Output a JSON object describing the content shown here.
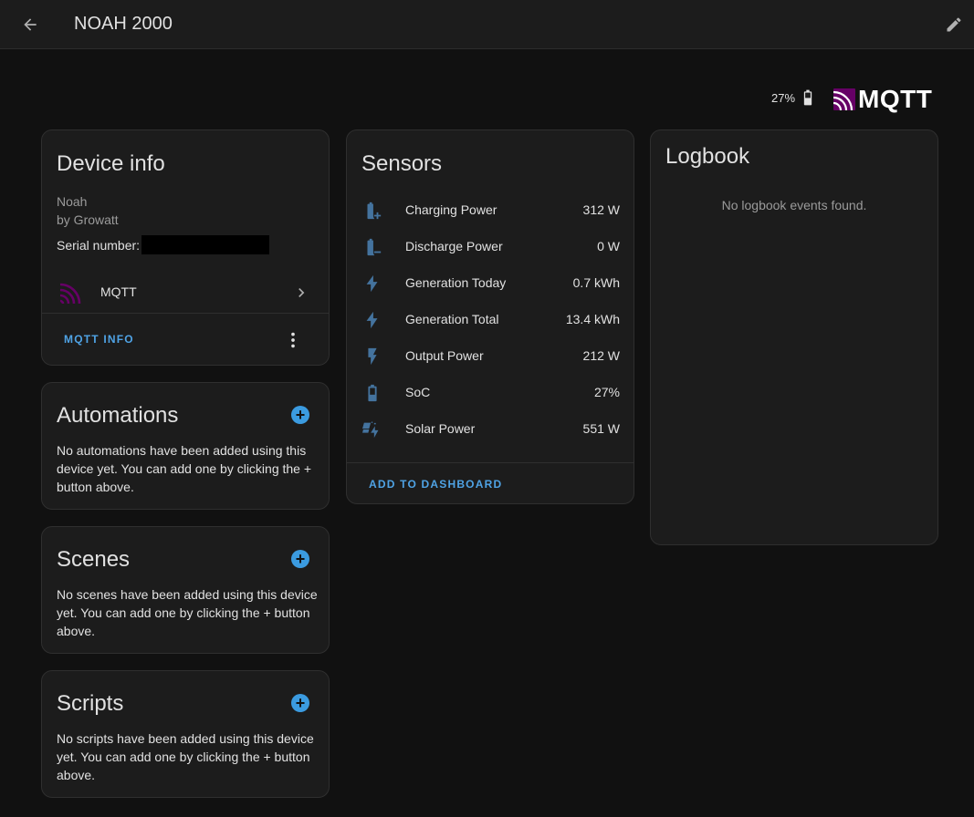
{
  "header": {
    "title": "NOAH 2000"
  },
  "status": {
    "battery_text": "27%",
    "integration_logo_text": "MQTT"
  },
  "device_info": {
    "title": "Device info",
    "model": "Noah",
    "manufacturer": "by Growatt",
    "serial_label": "Serial number:",
    "integration_name": "MQTT",
    "info_button": "MQTT INFO"
  },
  "automations": {
    "title": "Automations",
    "empty_text": "No automations have been added using this device yet. You can add one by clicking the + button above."
  },
  "scenes": {
    "title": "Scenes",
    "empty_text": "No scenes have been added using this device yet. You can add one by clicking the + button above."
  },
  "scripts": {
    "title": "Scripts",
    "empty_text": "No scripts have been added using this device yet. You can add one by clicking the + button above."
  },
  "sensors": {
    "title": "Sensors",
    "items": [
      {
        "name": "Charging Power",
        "value": "312 W",
        "icon": "battery-charging-icon"
      },
      {
        "name": "Discharge Power",
        "value": "0 W",
        "icon": "battery-minus-icon"
      },
      {
        "name": "Generation Today",
        "value": "0.7 kWh",
        "icon": "flash-icon"
      },
      {
        "name": "Generation Total",
        "value": "13.4 kWh",
        "icon": "flash-icon"
      },
      {
        "name": "Output Power",
        "value": "212 W",
        "icon": "lightning-bolt-icon"
      },
      {
        "name": "SoC",
        "value": "27%",
        "icon": "battery-icon"
      },
      {
        "name": "Solar Power",
        "value": "551 W",
        "icon": "solar-power-icon"
      }
    ],
    "add_button": "ADD TO DASHBOARD"
  },
  "logbook": {
    "title": "Logbook",
    "empty_text": "No logbook events found."
  },
  "colors": {
    "accent": "#3b9be0",
    "mqtt_purple": "#660066",
    "background": "#111111",
    "card": "#1c1c1c",
    "icon": "#44739e"
  }
}
